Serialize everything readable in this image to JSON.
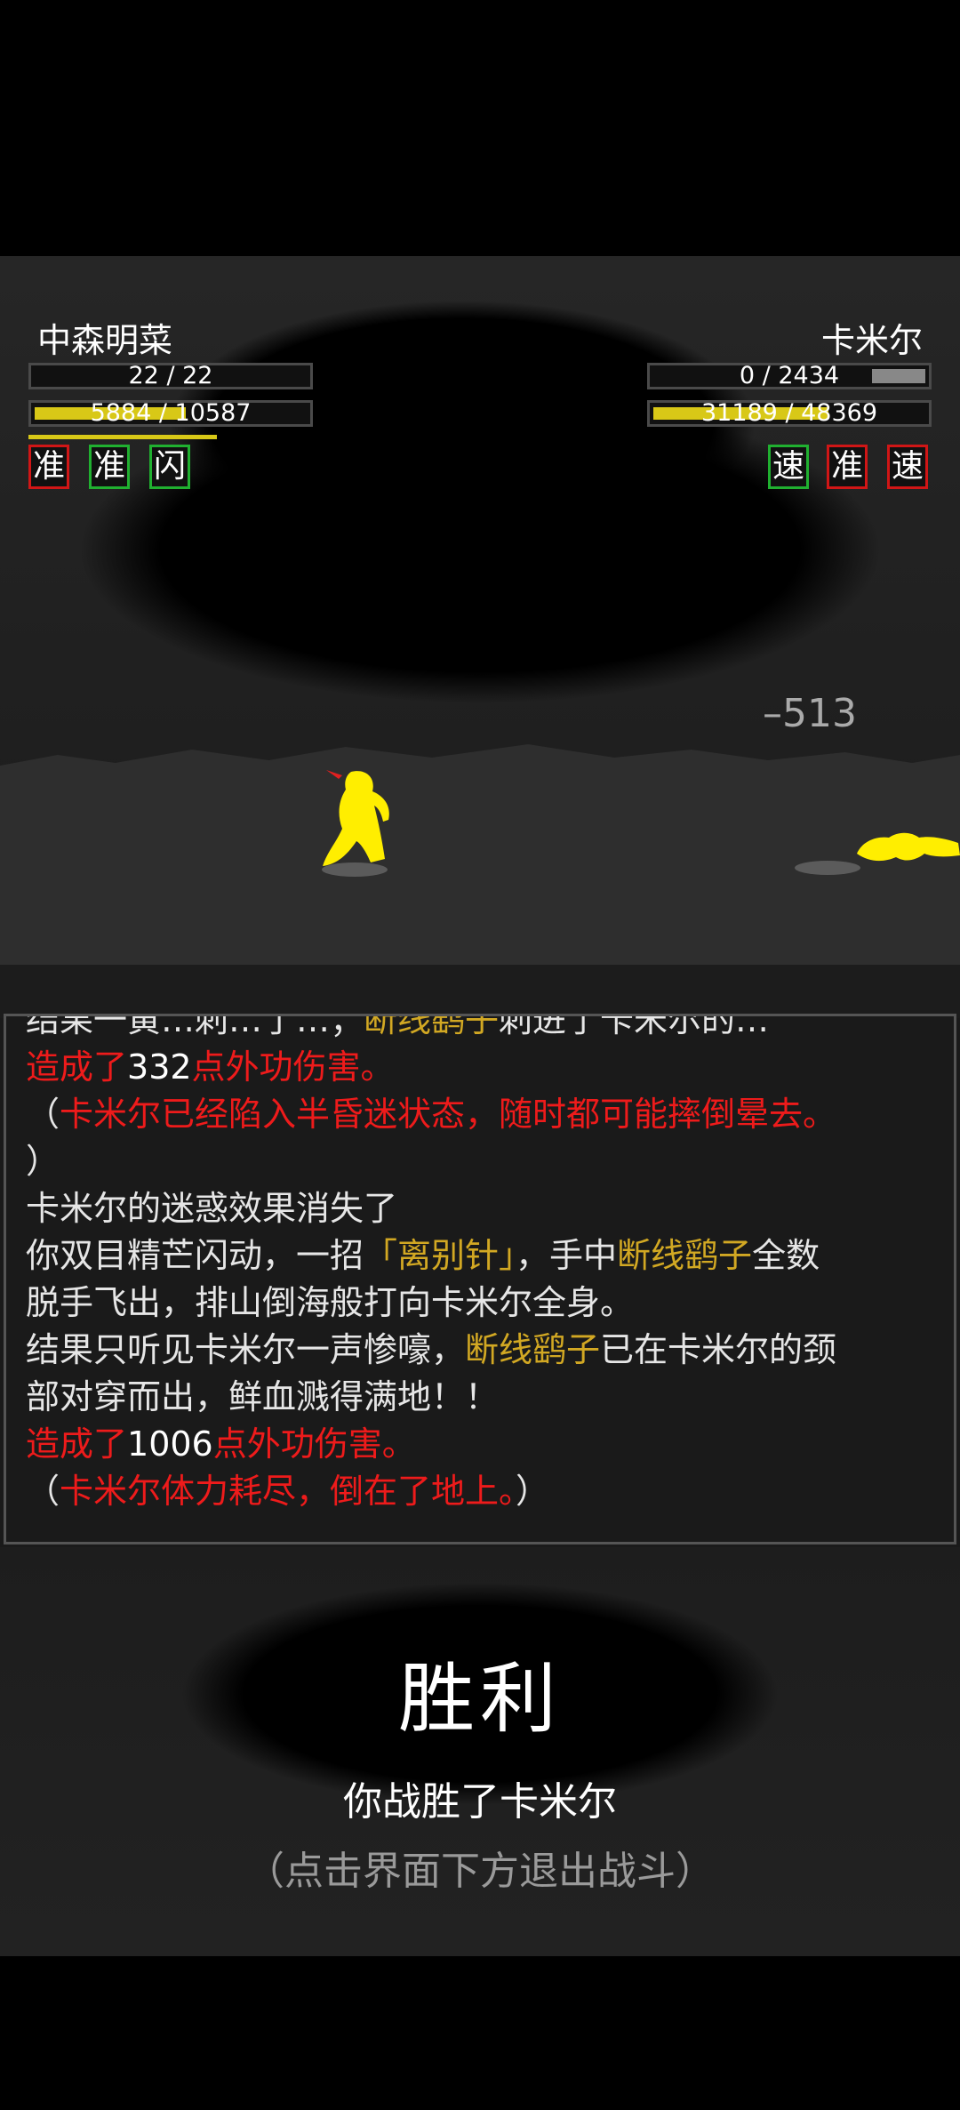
{
  "player": {
    "name": "中森明菜",
    "mp_text": "22 / 22",
    "mp_fraction": 1.0,
    "hp_text": "5884 / 10587",
    "hp_fraction": 0.556,
    "buffs": [
      {
        "label": "准",
        "border": "red"
      },
      {
        "label": "准",
        "border": "green"
      },
      {
        "label": "闪",
        "border": "green"
      }
    ]
  },
  "enemy": {
    "name": "卡米尔",
    "mp_text": "0 / 2434",
    "mp_fraction": 0.0,
    "hp_text": "31189 / 48369",
    "hp_fraction": 0.645,
    "buffs": [
      {
        "label": "速",
        "border": "green"
      },
      {
        "label": "准",
        "border": "red"
      },
      {
        "label": "速",
        "border": "red"
      }
    ]
  },
  "damage_popup": "–513",
  "colors": {
    "hp_bar": "#d8c817",
    "mp_bar_empty": "#888888",
    "log_red": "#ee1b1b",
    "log_yellow": "#d2a823"
  },
  "log": {
    "line0": {
      "a": "结果一黄…刺…了…；",
      "b": "断线鹞子",
      "c": "刺进了卡米尔的…"
    },
    "line1": {
      "a": "造成了",
      "b": "332",
      "c": "点外功伤害。"
    },
    "line2": {
      "a": "（",
      "b": "卡米尔已经陷入半昏迷状态，随时都可能摔倒晕去。"
    },
    "line3": {
      "a": "）"
    },
    "line4": {
      "a": "卡米尔的迷惑效果消失了"
    },
    "line5": {
      "a": "你双目精芒闪动，一招",
      "b": "「离别针」",
      "c": "，手中",
      "d": "断线鹞子",
      "e": "全数"
    },
    "line6": {
      "a": "脱手飞出，排山倒海般打向卡米尔全身。"
    },
    "line7": {
      "a": "结果只听见卡米尔一声惨嚎，",
      "b": "断线鹞子",
      "c": "已在卡米尔的颈"
    },
    "line8": {
      "a": "部对穿而出，鲜血溅得满地！！"
    },
    "line9": {
      "a": "造成了",
      "b": "1006",
      "c": "点外功伤害。"
    },
    "line10": {
      "a": "（",
      "b": "卡米尔体力耗尽，倒在了地上。",
      "c": "）"
    }
  },
  "victory": {
    "title": "胜利",
    "message": "你战胜了卡米尔",
    "hint": "（点击界面下方退出战斗）"
  }
}
